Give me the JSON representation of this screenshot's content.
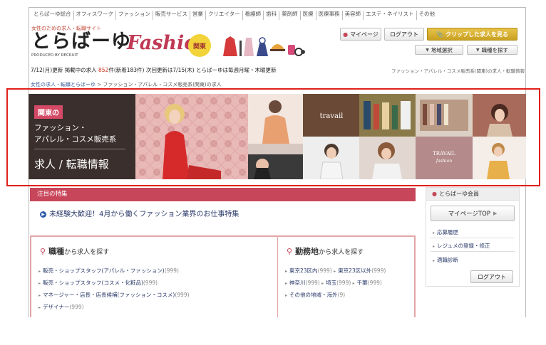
{
  "topnav": [
    "とらばーゆ総合",
    "オフィスワーク",
    "ファッション",
    "販売サービス",
    "営業",
    "クリエイター",
    "看護師",
    "歯科",
    "薬剤師",
    "医療",
    "医療事務",
    "美容師",
    "エステ・ネイリスト",
    "その他"
  ],
  "header": {
    "subtitle": "女性のための求人・転職サイト",
    "logo": "とらばーゆ",
    "produced_by": "PRODUCED BY RECRUIT",
    "fashion": "Fashion",
    "region_badge": "関東",
    "mypage": "マイページ",
    "logout": "ログアウト",
    "clip": "クリップした求人を見る",
    "region_select": "地域選択",
    "job_search": "職種を探す"
  },
  "status": {
    "date": "7/12(月)更新",
    "listing_prefix": "掲載中の求人",
    "count": "852",
    "count_unit": "件",
    "new": "(新着183件)",
    "next": "次回更新は7/15(木)",
    "schedule": "とらばーゆは毎週月曜・木曜更新",
    "right": "ファッション・アパレル・コスメ販売系(関東)の求人・転職情報"
  },
  "breadcrumb": {
    "home": "女性の求人・転職とらばーゆ",
    "separator": " > ",
    "current": "ファッション・アパレル・コスメ販売系(関東)の求人"
  },
  "banner": {
    "region": "関東の",
    "line1": "ファッション・",
    "line2": "アパレル・コスメ販売系",
    "line3": "求人 / 転職情報",
    "travail1": "travail",
    "travail2": "TRAVAIL",
    "travail2_sub": "fashion"
  },
  "feature": {
    "heading": "注目の特集",
    "link": "未経験大歓迎！4月から働くファッション業界のお仕事特集"
  },
  "search_job": {
    "title": "職種",
    "suffix": "から求人を探す",
    "items": [
      {
        "label": "販売・ショップスタッフ(アパレル・ファッション)",
        "count": "(999)"
      },
      {
        "label": "販売・ショップスタッフ(コスメ・化粧品)",
        "count": "(999)"
      },
      {
        "label": "マネージャー・店長・店長候補(ファッション・コスメ)",
        "count": "(999)"
      },
      {
        "label": "デザイナー",
        "count": "(999)"
      }
    ]
  },
  "search_area": {
    "title": "勤務地",
    "suffix": "から求人を探す",
    "row1": [
      {
        "label": "東京23区内",
        "count": "(999)"
      },
      {
        "label": "東京23区以外",
        "count": "(999)"
      }
    ],
    "row2": [
      {
        "label": "神奈川",
        "count": "(999)"
      },
      {
        "label": "埼玉",
        "count": "(999)"
      },
      {
        "label": "千葉",
        "count": "(999)"
      }
    ],
    "row3": {
      "label": "その他の地域・海外",
      "count": "(9)"
    }
  },
  "sidebar": {
    "heading": "とらばーゆ会員",
    "mypage_top": "マイページTOP",
    "items": [
      "応募履歴",
      "レジュメの登録・修正",
      "適職診断"
    ],
    "logout": "ログアウト"
  },
  "colors": {
    "accent": "#c8465a",
    "gold": "#d4ac2a",
    "frame": "#e0201a"
  }
}
